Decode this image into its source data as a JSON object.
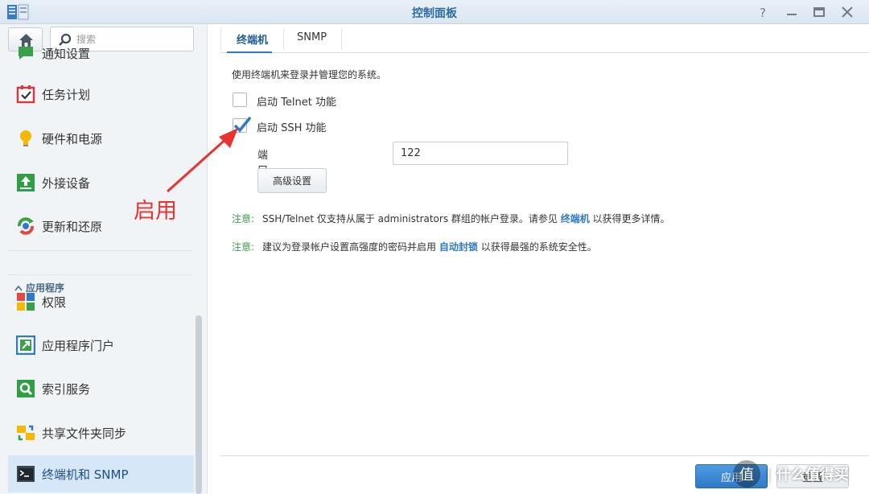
{
  "window": {
    "title": "控制面板",
    "controls": [
      "help-icon",
      "minimize-icon",
      "maximize-icon",
      "close-icon"
    ]
  },
  "sidebar": {
    "search_placeholder": "搜索",
    "items": [
      {
        "label": "通知设置",
        "icon": "chat-bubble-icon"
      },
      {
        "label": "任务计划",
        "icon": "calendar-check-icon"
      },
      {
        "label": "硬件和电源",
        "icon": "lightbulb-icon"
      },
      {
        "label": "外接设备",
        "icon": "upload-arrow-icon"
      },
      {
        "label": "更新和还原",
        "icon": "refresh-icon"
      },
      {
        "label": "权限",
        "icon": "tiles-icon"
      },
      {
        "label": "应用程序门户",
        "icon": "portal-arrow-icon"
      },
      {
        "label": "索引服务",
        "icon": "magnifier-icon"
      },
      {
        "label": "共享文件夹同步",
        "icon": "sync-folder-icon"
      },
      {
        "label": "终端机和 SNMP",
        "icon": "terminal-icon"
      }
    ],
    "section": "应用程序",
    "active": "终端机和 SNMP"
  },
  "tabs": [
    {
      "label": "终端机"
    },
    {
      "label": "SNMP"
    }
  ],
  "terminal": {
    "description": "使用终端机来登录并管理您的系统。",
    "telnet": {
      "label": "启动 Telnet 功能",
      "checked": false
    },
    "ssh": {
      "label": "启动 SSH 功能",
      "checked": true
    },
    "port_label": "端口:",
    "port_value": "122",
    "advanced_button": "高级设置",
    "notes": [
      {
        "tag": "注意:",
        "text": "SSH/Telnet 仅支持从属于 administrators 群组的帐户登录。请参见 ",
        "link": "终端机",
        "suffix": " 以获得更多详情。"
      },
      {
        "tag": "注意:",
        "text": "建议为登录帐户设置高强度的密码并启用 ",
        "link": "自动封锁",
        "suffix": " 以获得最强的系统安全性。"
      }
    ]
  },
  "footer": {
    "apply": "应用",
    "reset": "重置"
  },
  "annotation": {
    "text": "启用",
    "color": "#e8332e"
  },
  "watermark": {
    "text": "值 | 什么值得买"
  },
  "colors": {
    "accent": "#2f79c6",
    "note_tag": "#3aa04a",
    "active_nav": "#d6e7f7"
  }
}
